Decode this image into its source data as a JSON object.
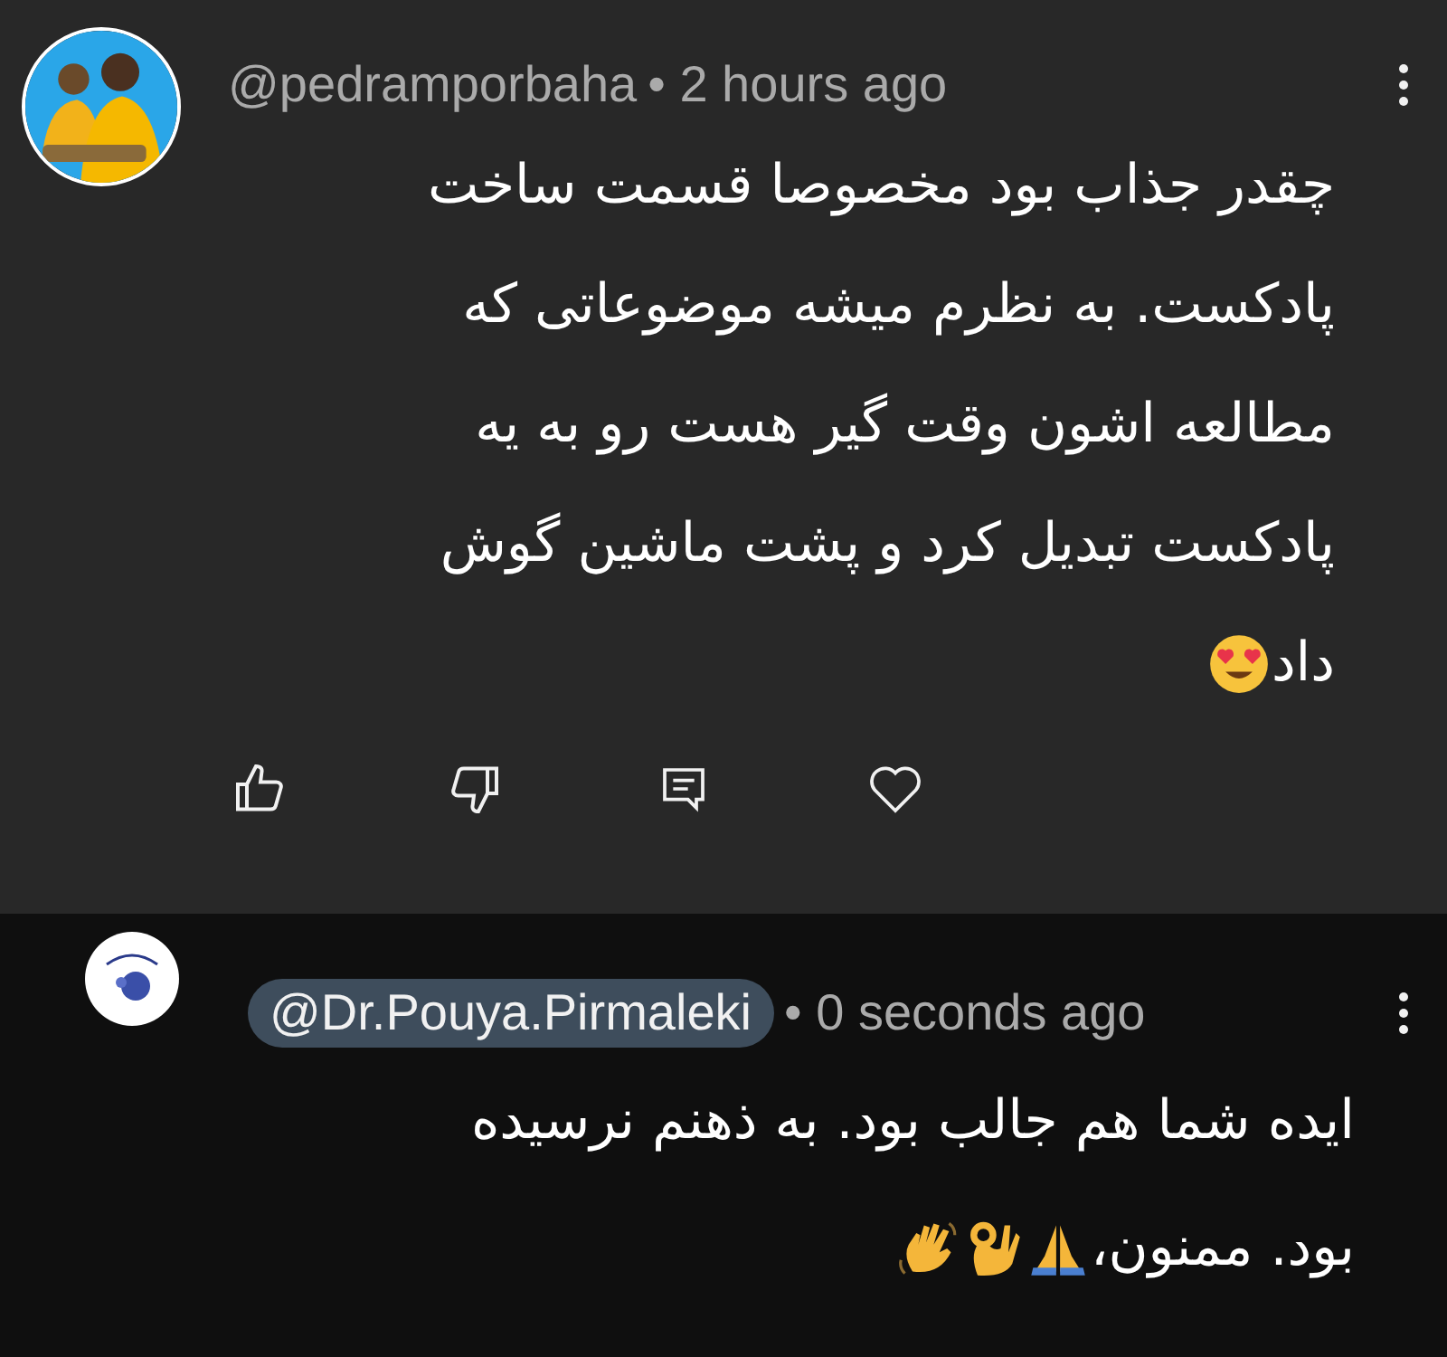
{
  "comments": [
    {
      "kind": "comment",
      "author": "@pedramporbaha",
      "time": "• 2 hours ago",
      "mention": false,
      "lines": [
        "چقدر جذاب بود مخصوصا قسمت ساخت",
        "پادکست. به نظرم میشه موضوعاتی که",
        "مطالعه اشون وقت گیر هست رو به یه",
        "پادکست تبدیل کرد و پشت ماشین گوش",
        "داد"
      ],
      "actions": true
    },
    {
      "kind": "reply",
      "author": "@Dr.Pouya.Pirmaleki",
      "time": "• 0 seconds ago",
      "mention": true,
      "lines": [
        "ایده شما هم جالب بود. به ذهنم نرسیده",
        "بود. ممنون،"
      ],
      "actions": false
    }
  ]
}
